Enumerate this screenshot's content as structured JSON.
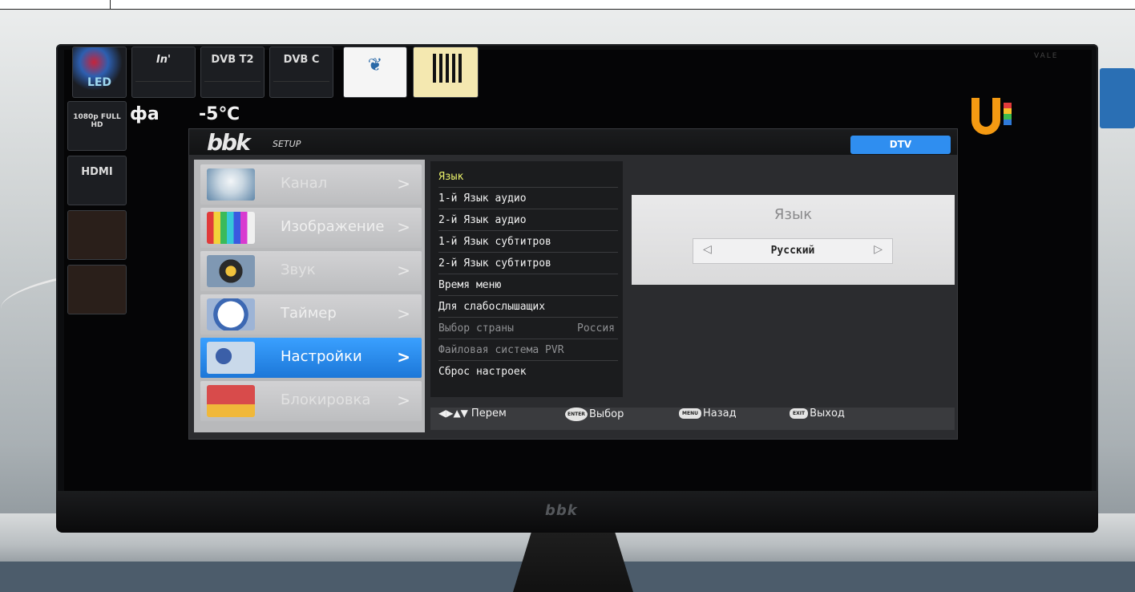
{
  "stickers": {
    "led": "LED",
    "intro": "In'",
    "dvbt2": "DVB T2",
    "dvbc": "DVB C",
    "fullhd": "1080p FULL HD",
    "hdmi": "HDMI"
  },
  "bezel": {
    "logo": "bbk",
    "corner_brand": "VALE"
  },
  "overlay": {
    "city": "фа",
    "temperature": "-5℃"
  },
  "osd": {
    "brand": "bbk",
    "section": "SETUP",
    "mode_badge": "DTV",
    "main_menu": [
      {
        "label": "Канал",
        "icon": "satellite-dish-icon",
        "state": "dim"
      },
      {
        "label": "Изображение",
        "icon": "test-pattern-icon",
        "state": "normal"
      },
      {
        "label": "Звук",
        "icon": "speaker-icon",
        "state": "dim"
      },
      {
        "label": "Таймер",
        "icon": "clock-icon",
        "state": "normal"
      },
      {
        "label": "Настройки",
        "icon": "gear-icon",
        "state": "active"
      },
      {
        "label": "Блокировка",
        "icon": "lock-icon",
        "state": "dim"
      }
    ],
    "chevron": ">",
    "sub_menu": [
      {
        "label": "Язык",
        "state": "selected"
      },
      {
        "label": "1-й Язык аудио",
        "state": "normal"
      },
      {
        "label": "2-й Язык аудио",
        "state": "normal"
      },
      {
        "label": "1-й Язык субтитров",
        "state": "normal"
      },
      {
        "label": "2-й Язык субтитров",
        "state": "normal"
      },
      {
        "label": "Время меню",
        "state": "normal"
      },
      {
        "label": "Для слабослышащих",
        "state": "normal"
      },
      {
        "label": "Выбор страны",
        "value": "Россия",
        "state": "disabled"
      },
      {
        "label": "Файловая система PVR",
        "state": "disabled"
      },
      {
        "label": "Сброс настроек",
        "state": "normal"
      }
    ],
    "detail": {
      "title": "Язык",
      "value": "Русский",
      "left_arrow": "◁",
      "right_arrow": "▷"
    },
    "footer": {
      "move_arrows": "◀▶▲▼",
      "move_label": "Перем",
      "enter_key": "ENTER",
      "select_label": "Выбор",
      "menu_key": "MENU",
      "back_label": "Назад",
      "exit_key": "EXIT",
      "exit_label": "Выход"
    }
  },
  "colors": {
    "active_item": "#2f8ef0",
    "selected_text": "#e8ef6a",
    "channel_logo": "#f49a12"
  }
}
